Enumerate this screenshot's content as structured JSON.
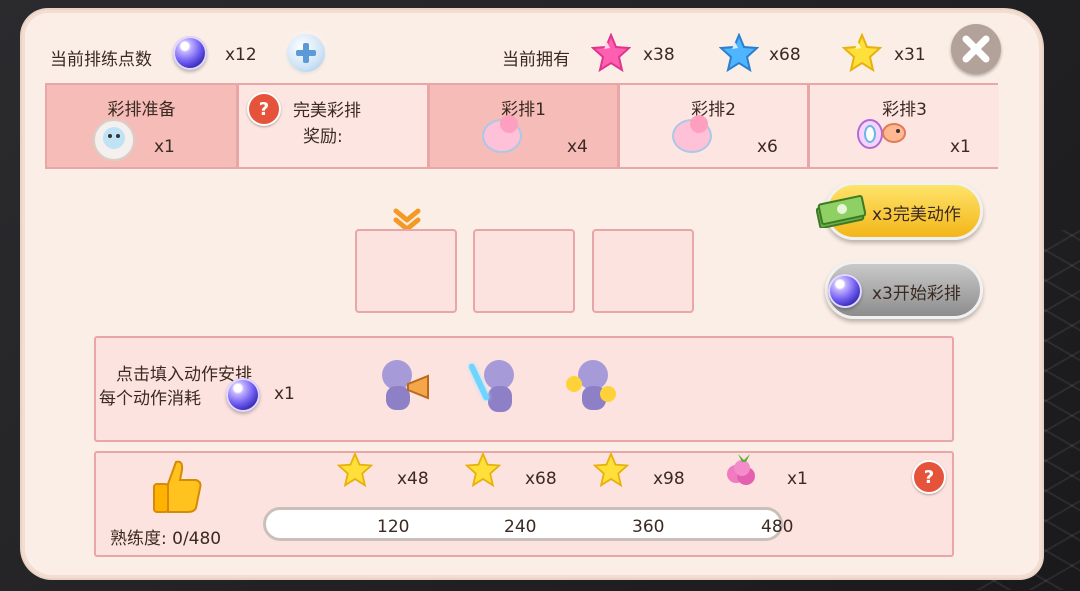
{
  "header": {
    "points_label": "当前排练点数",
    "points_count": "x12",
    "owned_label": "当前拥有",
    "pink_star_count": "x38",
    "blue_star_count": "x68",
    "yellow_star_count": "x31"
  },
  "tabs": [
    {
      "label": "彩排准备",
      "count": "x1"
    },
    {
      "label": "完美彩排",
      "sub": "奖励:"
    },
    {
      "label": "彩排1",
      "count": "x4"
    },
    {
      "label": "彩排2",
      "count": "x6"
    },
    {
      "label": "彩排3",
      "count": "x1"
    }
  ],
  "buttons": {
    "perfect_action": "x3完美动作",
    "start_rehearsal": "x3开始彩排"
  },
  "actions_panel": {
    "line1": "点击填入动作安排",
    "line2": "每个动作消耗",
    "cost": "x1"
  },
  "mastery": {
    "label": "熟练度: 0/480",
    "value": 0,
    "max": 480,
    "rewards": [
      {
        "icon": "yellow-star-icon",
        "count": "x48"
      },
      {
        "icon": "yellow-star-icon",
        "count": "x68"
      },
      {
        "icon": "yellow-star-icon",
        "count": "x98"
      },
      {
        "icon": "berry-icon",
        "count": "x1"
      }
    ],
    "milestones": [
      "120",
      "240",
      "360",
      "480"
    ]
  },
  "colors": {
    "parchment": "#fbeee6",
    "tab_active": "#f6bcb8",
    "tab_inactive": "#fde5e2",
    "border_pink": "#e8a6a6",
    "gold_button": "#f3b619",
    "gray_button": "#8d8d8d"
  }
}
